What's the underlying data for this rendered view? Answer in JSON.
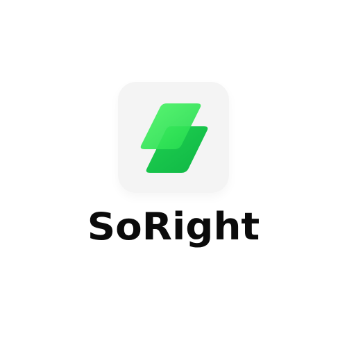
{
  "brand": {
    "name": "SoRight",
    "icon": "stacked-parallelogram-logo-icon",
    "colors": {
      "icon_background": "#f4f4f4",
      "green_light": "#3df05a",
      "green_dark": "#12c24a",
      "text": "#0b0b0b",
      "page_background": "#ffffff"
    }
  }
}
